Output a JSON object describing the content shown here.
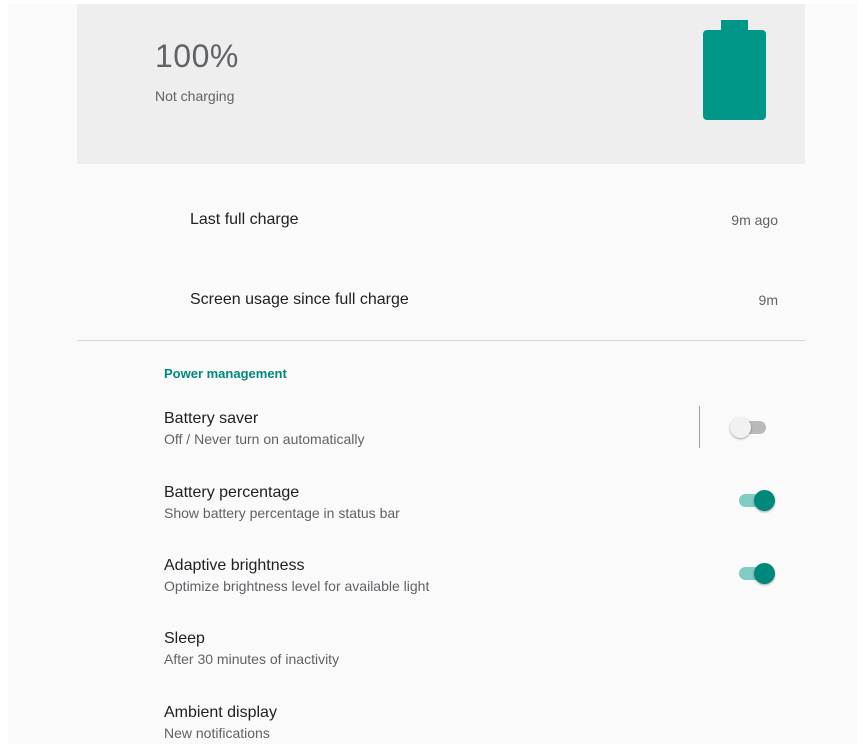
{
  "battery": {
    "level_text": "100%",
    "status_text": "Not charging",
    "level_fraction": 1.0,
    "accent": "#009688"
  },
  "stats": [
    {
      "label": "Last full charge",
      "value": "9m ago"
    },
    {
      "label": "Screen usage since full charge",
      "value": "9m"
    }
  ],
  "section": {
    "title": "Power management"
  },
  "prefs": [
    {
      "title": "Battery saver",
      "summary": "Off / Never turn on automatically",
      "switch": "off"
    },
    {
      "title": "Battery percentage",
      "summary": "Show battery percentage in status bar",
      "switch": "on"
    },
    {
      "title": "Adaptive brightness",
      "summary": "Optimize brightness level for available light",
      "switch": "on"
    },
    {
      "title": "Sleep",
      "summary": "After 30 minutes of inactivity"
    },
    {
      "title": "Ambient display",
      "summary": "New notifications"
    }
  ],
  "colors": {
    "accent": "#00897b",
    "switch_track_on": "#80cbc4",
    "switch_track_off": "#b9b9b9"
  }
}
